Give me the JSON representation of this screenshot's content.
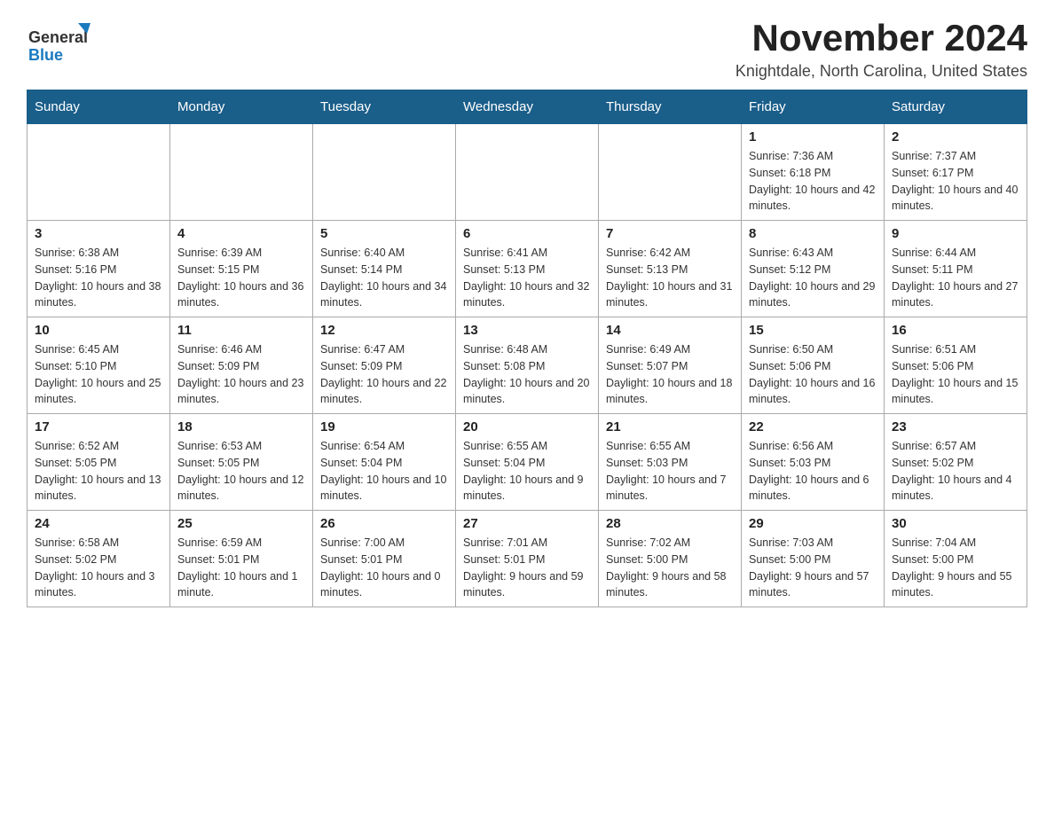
{
  "logo": {
    "text_general": "General",
    "text_blue": "Blue"
  },
  "header": {
    "month_year": "November 2024",
    "location": "Knightdale, North Carolina, United States"
  },
  "days_of_week": [
    "Sunday",
    "Monday",
    "Tuesday",
    "Wednesday",
    "Thursday",
    "Friday",
    "Saturday"
  ],
  "weeks": [
    [
      {
        "day": "",
        "info": ""
      },
      {
        "day": "",
        "info": ""
      },
      {
        "day": "",
        "info": ""
      },
      {
        "day": "",
        "info": ""
      },
      {
        "day": "",
        "info": ""
      },
      {
        "day": "1",
        "info": "Sunrise: 7:36 AM\nSunset: 6:18 PM\nDaylight: 10 hours and 42 minutes."
      },
      {
        "day": "2",
        "info": "Sunrise: 7:37 AM\nSunset: 6:17 PM\nDaylight: 10 hours and 40 minutes."
      }
    ],
    [
      {
        "day": "3",
        "info": "Sunrise: 6:38 AM\nSunset: 5:16 PM\nDaylight: 10 hours and 38 minutes."
      },
      {
        "day": "4",
        "info": "Sunrise: 6:39 AM\nSunset: 5:15 PM\nDaylight: 10 hours and 36 minutes."
      },
      {
        "day": "5",
        "info": "Sunrise: 6:40 AM\nSunset: 5:14 PM\nDaylight: 10 hours and 34 minutes."
      },
      {
        "day": "6",
        "info": "Sunrise: 6:41 AM\nSunset: 5:13 PM\nDaylight: 10 hours and 32 minutes."
      },
      {
        "day": "7",
        "info": "Sunrise: 6:42 AM\nSunset: 5:13 PM\nDaylight: 10 hours and 31 minutes."
      },
      {
        "day": "8",
        "info": "Sunrise: 6:43 AM\nSunset: 5:12 PM\nDaylight: 10 hours and 29 minutes."
      },
      {
        "day": "9",
        "info": "Sunrise: 6:44 AM\nSunset: 5:11 PM\nDaylight: 10 hours and 27 minutes."
      }
    ],
    [
      {
        "day": "10",
        "info": "Sunrise: 6:45 AM\nSunset: 5:10 PM\nDaylight: 10 hours and 25 minutes."
      },
      {
        "day": "11",
        "info": "Sunrise: 6:46 AM\nSunset: 5:09 PM\nDaylight: 10 hours and 23 minutes."
      },
      {
        "day": "12",
        "info": "Sunrise: 6:47 AM\nSunset: 5:09 PM\nDaylight: 10 hours and 22 minutes."
      },
      {
        "day": "13",
        "info": "Sunrise: 6:48 AM\nSunset: 5:08 PM\nDaylight: 10 hours and 20 minutes."
      },
      {
        "day": "14",
        "info": "Sunrise: 6:49 AM\nSunset: 5:07 PM\nDaylight: 10 hours and 18 minutes."
      },
      {
        "day": "15",
        "info": "Sunrise: 6:50 AM\nSunset: 5:06 PM\nDaylight: 10 hours and 16 minutes."
      },
      {
        "day": "16",
        "info": "Sunrise: 6:51 AM\nSunset: 5:06 PM\nDaylight: 10 hours and 15 minutes."
      }
    ],
    [
      {
        "day": "17",
        "info": "Sunrise: 6:52 AM\nSunset: 5:05 PM\nDaylight: 10 hours and 13 minutes."
      },
      {
        "day": "18",
        "info": "Sunrise: 6:53 AM\nSunset: 5:05 PM\nDaylight: 10 hours and 12 minutes."
      },
      {
        "day": "19",
        "info": "Sunrise: 6:54 AM\nSunset: 5:04 PM\nDaylight: 10 hours and 10 minutes."
      },
      {
        "day": "20",
        "info": "Sunrise: 6:55 AM\nSunset: 5:04 PM\nDaylight: 10 hours and 9 minutes."
      },
      {
        "day": "21",
        "info": "Sunrise: 6:55 AM\nSunset: 5:03 PM\nDaylight: 10 hours and 7 minutes."
      },
      {
        "day": "22",
        "info": "Sunrise: 6:56 AM\nSunset: 5:03 PM\nDaylight: 10 hours and 6 minutes."
      },
      {
        "day": "23",
        "info": "Sunrise: 6:57 AM\nSunset: 5:02 PM\nDaylight: 10 hours and 4 minutes."
      }
    ],
    [
      {
        "day": "24",
        "info": "Sunrise: 6:58 AM\nSunset: 5:02 PM\nDaylight: 10 hours and 3 minutes."
      },
      {
        "day": "25",
        "info": "Sunrise: 6:59 AM\nSunset: 5:01 PM\nDaylight: 10 hours and 1 minute."
      },
      {
        "day": "26",
        "info": "Sunrise: 7:00 AM\nSunset: 5:01 PM\nDaylight: 10 hours and 0 minutes."
      },
      {
        "day": "27",
        "info": "Sunrise: 7:01 AM\nSunset: 5:01 PM\nDaylight: 9 hours and 59 minutes."
      },
      {
        "day": "28",
        "info": "Sunrise: 7:02 AM\nSunset: 5:00 PM\nDaylight: 9 hours and 58 minutes."
      },
      {
        "day": "29",
        "info": "Sunrise: 7:03 AM\nSunset: 5:00 PM\nDaylight: 9 hours and 57 minutes."
      },
      {
        "day": "30",
        "info": "Sunrise: 7:04 AM\nSunset: 5:00 PM\nDaylight: 9 hours and 55 minutes."
      }
    ]
  ]
}
